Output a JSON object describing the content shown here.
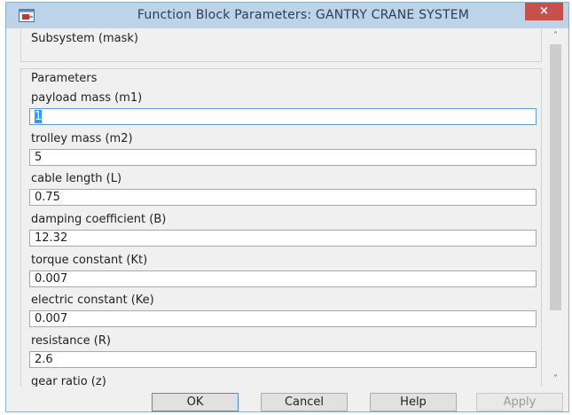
{
  "window": {
    "title": "Function Block Parameters: GANTRY CRANE SYSTEM",
    "close_glyph": "×"
  },
  "mask_section": {
    "label": "Subsystem (mask)"
  },
  "parameters": {
    "label": "Parameters",
    "fields": [
      {
        "label": "payload mass (m1)",
        "value": "1"
      },
      {
        "label": "trolley mass (m2)",
        "value": "5"
      },
      {
        "label": "cable length (L)",
        "value": "0.75"
      },
      {
        "label": "damping coefficient (B)",
        "value": "12.32"
      },
      {
        "label": "torque constant (Kt)",
        "value": "0.007"
      },
      {
        "label": "electric constant (Ke)",
        "value": "0.007"
      },
      {
        "label": "resistance (R)",
        "value": "2.6"
      },
      {
        "label": "gear ratio (z)",
        "value": ""
      }
    ]
  },
  "scrollbar": {
    "up_glyph": "˄",
    "down_glyph": "˅"
  },
  "buttons": {
    "ok": "OK",
    "cancel": "Cancel",
    "help": "Help",
    "apply": "Apply"
  },
  "icons": {
    "app": "simulink-block-icon",
    "close": "close-icon",
    "scroll_up": "chevron-up-icon",
    "scroll_down": "chevron-down-icon"
  },
  "colors": {
    "titlebar": "#bcd3ea",
    "close_button": "#c7504c",
    "focus_border": "#5d9fd6",
    "selection": "#3399ff"
  }
}
